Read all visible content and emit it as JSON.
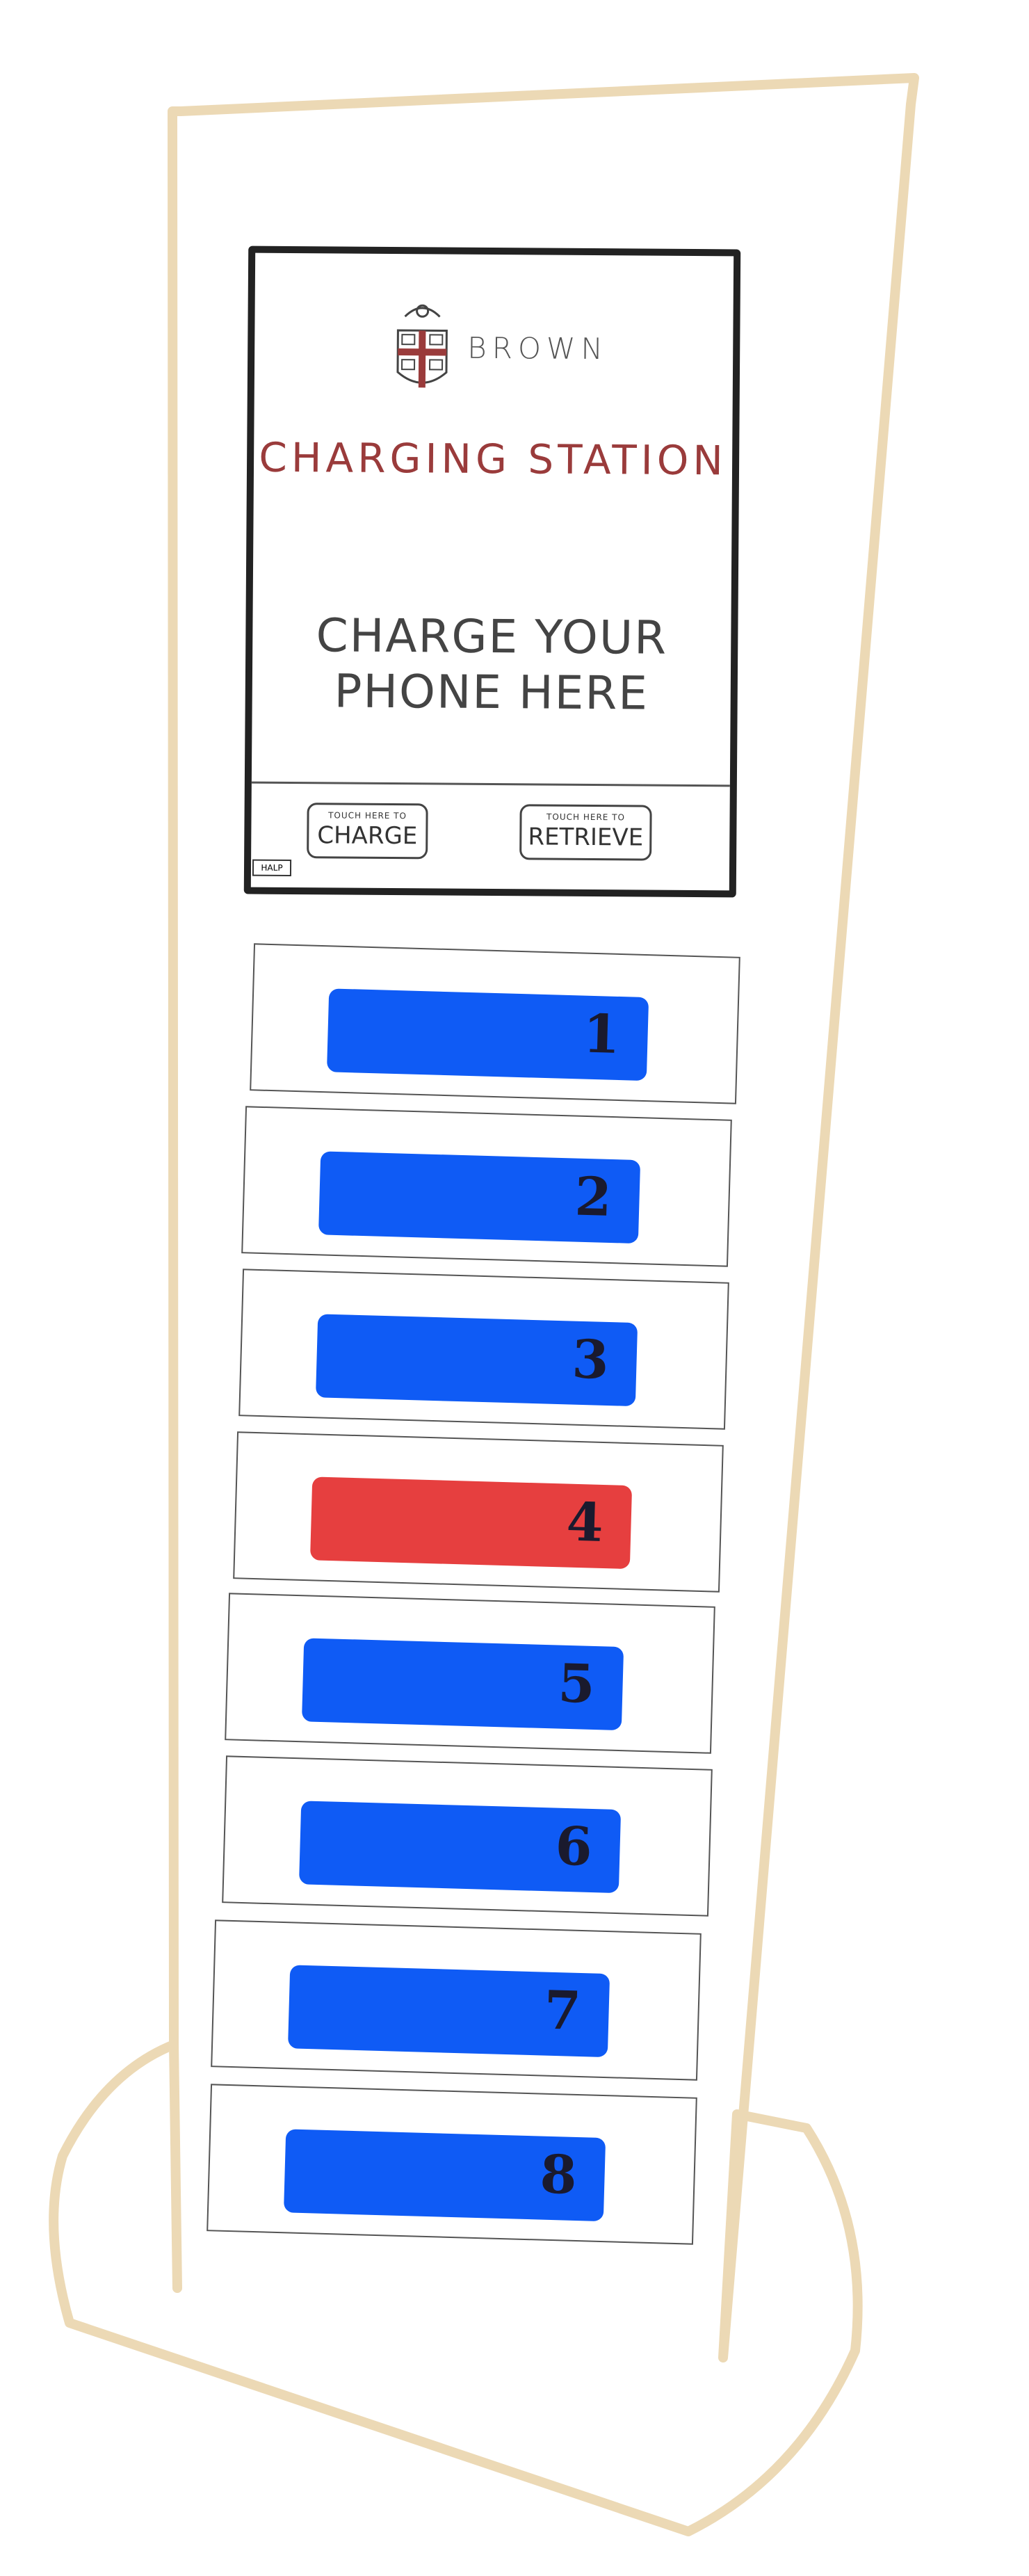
{
  "screen": {
    "brand": "BROWN",
    "title": "CHARGING STATION",
    "message_line1": "CHARGE YOUR",
    "message_line2": "PHONE HERE",
    "charge_button": {
      "hint": "TOUCH HERE TO",
      "label": "CHARGE"
    },
    "retrieve_button": {
      "hint": "TOUCH HERE TO",
      "label": "RETRIEVE"
    },
    "help_label": "HALP"
  },
  "lockers": [
    {
      "number": "1",
      "status": "available"
    },
    {
      "number": "2",
      "status": "available"
    },
    {
      "number": "3",
      "status": "available"
    },
    {
      "number": "4",
      "status": "occupied"
    },
    {
      "number": "5",
      "status": "available"
    },
    {
      "number": "6",
      "status": "available"
    },
    {
      "number": "7",
      "status": "available"
    },
    {
      "number": "8",
      "status": "available"
    }
  ],
  "colors": {
    "kiosk_outline": "#ecd9b5",
    "available": "#0f5bf5",
    "occupied": "#e63f3f",
    "title": "#9a3b3b"
  }
}
